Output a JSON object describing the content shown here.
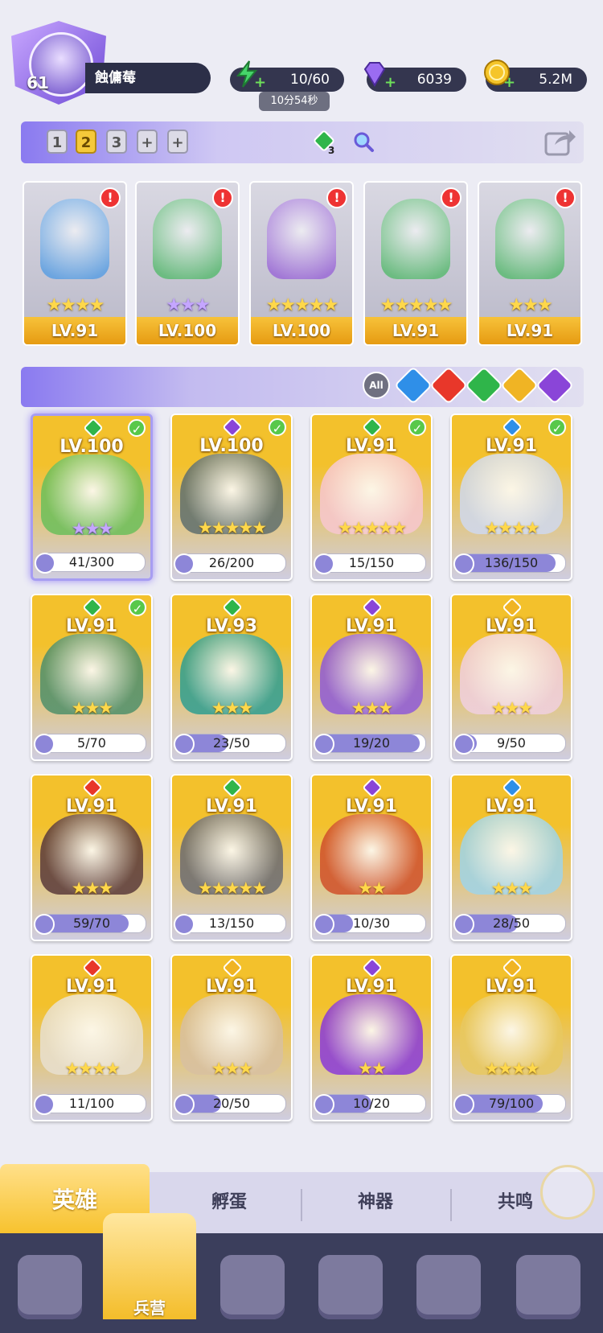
{
  "player": {
    "level": "61",
    "name": "蝕傭莓"
  },
  "resources": {
    "energy": "10/60",
    "energy_timer": "10分54秒",
    "gems": "6039",
    "gold": "5.2M"
  },
  "team_bar": {
    "teams": [
      "1",
      "2",
      "3",
      "+",
      "+"
    ],
    "active_team": "2",
    "element_counter": "3"
  },
  "team": [
    {
      "level": "LV.91",
      "stars": "★★★★",
      "star_type": "gold",
      "element": "water"
    },
    {
      "level": "LV.100",
      "stars": "★★★",
      "star_type": "purple",
      "element": "earth"
    },
    {
      "level": "LV.100",
      "stars": "★★★★★",
      "star_type": "gold",
      "element": "dark"
    },
    {
      "level": "LV.91",
      "stars": "★★★★★",
      "star_type": "gold",
      "element": "earth"
    },
    {
      "level": "LV.91",
      "stars": "★★★",
      "star_type": "gold",
      "element": "earth"
    }
  ],
  "filter": {
    "all_label": "All"
  },
  "heroes": [
    {
      "level": "LV.100",
      "fragments": "41/300",
      "progress": 0.14,
      "stars": "★★★",
      "star_type": "purple",
      "element": "earth",
      "owned": true
    },
    {
      "level": "LV.100",
      "fragments": "26/200",
      "progress": 0.13,
      "stars": "★★★★★",
      "star_type": "gold",
      "element": "dark",
      "owned": true
    },
    {
      "level": "LV.91",
      "fragments": "15/150",
      "progress": 0.1,
      "stars": "★★★★★",
      "star_type": "gold",
      "element": "earth",
      "owned": true
    },
    {
      "level": "LV.91",
      "fragments": "136/150",
      "progress": 0.91,
      "stars": "★★★★",
      "star_type": "gold",
      "element": "water",
      "owned": true
    },
    {
      "level": "LV.91",
      "fragments": "5/70",
      "progress": 0.07,
      "stars": "★★★",
      "star_type": "gold",
      "element": "earth",
      "owned": true
    },
    {
      "level": "LV.93",
      "fragments": "23/50",
      "progress": 0.46,
      "stars": "★★★",
      "star_type": "gold",
      "element": "earth",
      "owned": false
    },
    {
      "level": "LV.91",
      "fragments": "19/20",
      "progress": 0.95,
      "stars": "★★★",
      "star_type": "gold",
      "element": "dark",
      "owned": false
    },
    {
      "level": "LV.91",
      "fragments": "9/50",
      "progress": 0.18,
      "stars": "★★★",
      "star_type": "gold",
      "element": "light",
      "owned": false
    },
    {
      "level": "LV.91",
      "fragments": "59/70",
      "progress": 0.84,
      "stars": "★★★",
      "star_type": "gold",
      "element": "fire",
      "owned": false
    },
    {
      "level": "LV.91",
      "fragments": "13/150",
      "progress": 0.09,
      "stars": "★★★★★",
      "star_type": "gold",
      "element": "earth",
      "owned": false
    },
    {
      "level": "LV.91",
      "fragments": "10/30",
      "progress": 0.33,
      "stars": "★★",
      "star_type": "gold",
      "element": "dark",
      "owned": false
    },
    {
      "level": "LV.91",
      "fragments": "28/50",
      "progress": 0.56,
      "stars": "★★★",
      "star_type": "gold",
      "element": "water",
      "owned": false
    },
    {
      "level": "LV.91",
      "fragments": "11/100",
      "progress": 0.11,
      "stars": "★★★★",
      "star_type": "gold",
      "element": "fire",
      "owned": false
    },
    {
      "level": "LV.91",
      "fragments": "20/50",
      "progress": 0.4,
      "stars": "★★★",
      "star_type": "gold",
      "element": "light",
      "owned": false
    },
    {
      "level": "LV.91",
      "fragments": "10/20",
      "progress": 0.5,
      "stars": "★★",
      "star_type": "gold",
      "element": "dark",
      "owned": false
    },
    {
      "level": "LV.91",
      "fragments": "79/100",
      "progress": 0.79,
      "stars": "★★★★",
      "star_type": "gold",
      "element": "light",
      "owned": false
    }
  ],
  "tabs": [
    "英雄",
    "孵蛋",
    "神器",
    "共鸣"
  ],
  "nav": {
    "active_label": "兵营"
  },
  "element_colors": {
    "water": "#2f8fe8",
    "fire": "#e8372a",
    "earth": "#2fb54a",
    "light": "#f0b424",
    "dark": "#8a45d8"
  },
  "art_colors": [
    "#6bbf5a",
    "#5f6f6e",
    "#f7c7d0",
    "#cfd9ef",
    "#4f8f6a",
    "#2f9e90",
    "#8e5ad8",
    "#f0d0e0",
    "#5a3a3a",
    "#6b6b70",
    "#d0502a",
    "#9fd4e8",
    "#e8e0d0",
    "#d8c0a0",
    "#8a3ad8",
    "#e8c860"
  ]
}
